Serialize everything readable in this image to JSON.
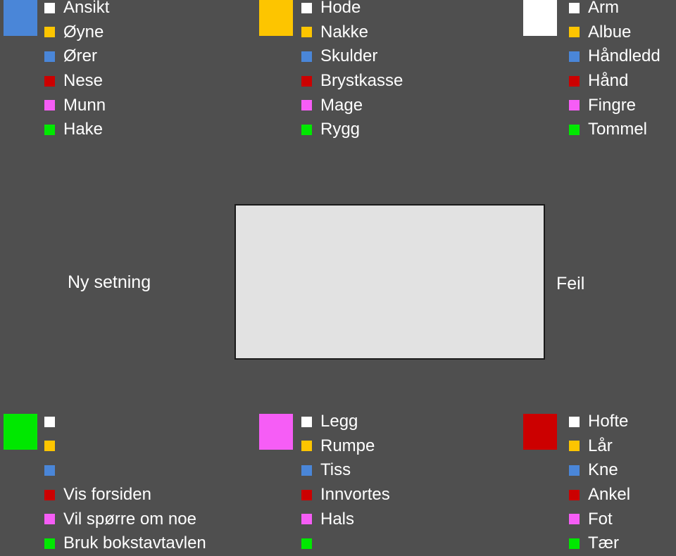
{
  "app": {
    "background_color": "#4f4f4f",
    "text_color": "#ffffff"
  },
  "palette": {
    "white": "#ffffff",
    "yellow": "#fdc500",
    "blue": "#4a86d8",
    "red": "#cc0000",
    "magenta": "#f65df6",
    "green": "#00e800"
  },
  "center": {
    "new_sentence_label": "Ny setning",
    "error_label": "Feil",
    "textbox_value": "",
    "textbox_placeholder": ""
  },
  "groups": [
    {
      "id": "face",
      "header_color": "#4a86d8",
      "items": [
        {
          "label": "Ansikt",
          "color": "#ffffff"
        },
        {
          "label": "Øyne",
          "color": "#fdc500"
        },
        {
          "label": "Ører",
          "color": "#4a86d8"
        },
        {
          "label": "Nese",
          "color": "#cc0000"
        },
        {
          "label": "Munn",
          "color": "#f65df6"
        },
        {
          "label": "Hake",
          "color": "#00e800"
        }
      ]
    },
    {
      "id": "torso",
      "header_color": "#fdc500",
      "items": [
        {
          "label": "Hode",
          "color": "#ffffff"
        },
        {
          "label": "Nakke",
          "color": "#fdc500"
        },
        {
          "label": "Skulder",
          "color": "#4a86d8"
        },
        {
          "label": "Brystkasse",
          "color": "#cc0000"
        },
        {
          "label": "Mage",
          "color": "#f65df6"
        },
        {
          "label": "Rygg",
          "color": "#00e800"
        }
      ]
    },
    {
      "id": "arm",
      "header_color": "#ffffff",
      "items": [
        {
          "label": "Arm",
          "color": "#ffffff"
        },
        {
          "label": "Albue",
          "color": "#fdc500"
        },
        {
          "label": "Håndledd",
          "color": "#4a86d8"
        },
        {
          "label": "Hånd",
          "color": "#cc0000"
        },
        {
          "label": "Fingre",
          "color": "#f65df6"
        },
        {
          "label": "Tommel",
          "color": "#00e800"
        }
      ]
    },
    {
      "id": "misc",
      "header_color": "#00e800",
      "items": [
        {
          "label": "",
          "color": "#ffffff"
        },
        {
          "label": "",
          "color": "#fdc500"
        },
        {
          "label": "",
          "color": "#4a86d8"
        },
        {
          "label": "Vis forsiden",
          "color": "#cc0000"
        },
        {
          "label": "Vil spørre om noe",
          "color": "#f65df6"
        },
        {
          "label": "Bruk bokstavtavlen",
          "color": "#00e800"
        }
      ]
    },
    {
      "id": "lower",
      "header_color": "#f65df6",
      "items": [
        {
          "label": "Legg",
          "color": "#ffffff"
        },
        {
          "label": "Rumpe",
          "color": "#fdc500"
        },
        {
          "label": "Tiss",
          "color": "#4a86d8"
        },
        {
          "label": "Innvortes",
          "color": "#cc0000"
        },
        {
          "label": "Hals",
          "color": "#f65df6"
        },
        {
          "label": "",
          "color": "#00e800"
        }
      ]
    },
    {
      "id": "leg",
      "header_color": "#cc0000",
      "items": [
        {
          "label": "Hofte",
          "color": "#ffffff"
        },
        {
          "label": "Lår",
          "color": "#fdc500"
        },
        {
          "label": "Kne",
          "color": "#4a86d8"
        },
        {
          "label": "Ankel",
          "color": "#cc0000"
        },
        {
          "label": "Fot",
          "color": "#f65df6"
        },
        {
          "label": "Tær",
          "color": "#00e800"
        }
      ]
    }
  ]
}
